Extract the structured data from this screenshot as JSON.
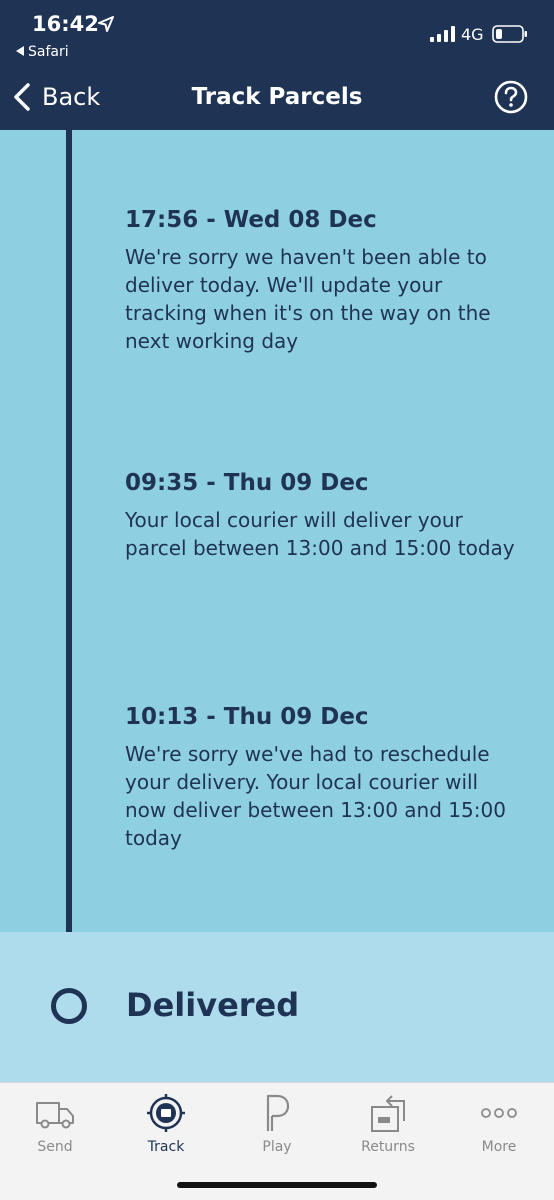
{
  "status_bar": {
    "time": "16:42",
    "back_app": "Safari",
    "network": "4G"
  },
  "nav": {
    "back_label": "Back",
    "title": "Track Parcels"
  },
  "events": [
    {
      "time": "17:56 - Wed 08 Dec",
      "text": "We're sorry we haven't been able to deliver today. We'll update your tracking when it's on the way on the next working day"
    },
    {
      "time": "09:35 - Thu 09 Dec",
      "text": "Your local courier will deliver your parcel between 13:00 and 15:00 today"
    },
    {
      "time": "10:13 - Thu 09 Dec",
      "text": "We're sorry we've had to reschedule your delivery. Your local courier will now deliver between 13:00 and 15:00 today"
    }
  ],
  "status": {
    "label": "Delivered"
  },
  "tabs": [
    {
      "label": "Send",
      "icon": "van-icon"
    },
    {
      "label": "Track",
      "icon": "target-icon",
      "active": true
    },
    {
      "label": "Play",
      "icon": "play-p-icon"
    },
    {
      "label": "Returns",
      "icon": "returns-box-icon"
    },
    {
      "label": "More",
      "icon": "more-dots-icon"
    }
  ],
  "colors": {
    "header": "#1f3354",
    "timeline_bg": "#8fcfe2",
    "delivered_bg": "#afdcec",
    "text": "#1f3354"
  }
}
